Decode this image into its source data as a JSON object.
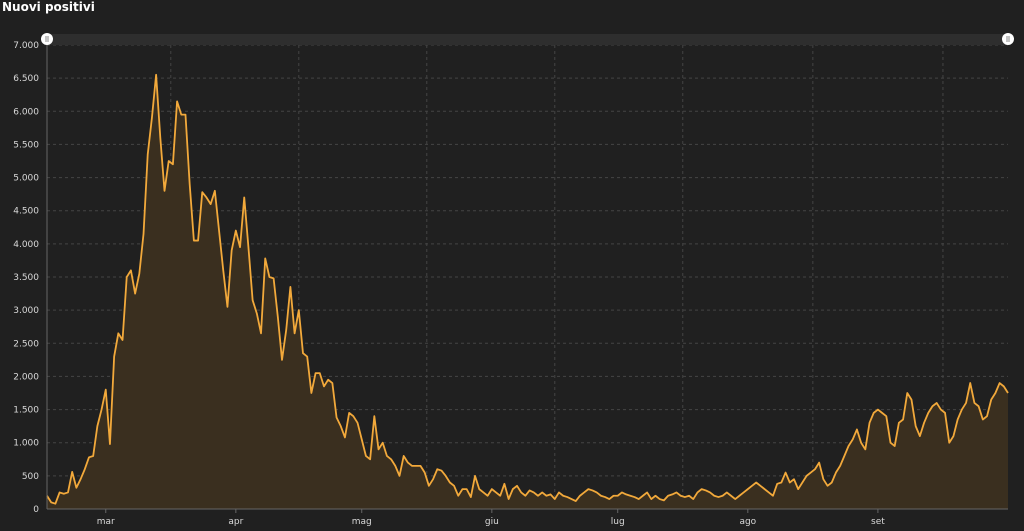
{
  "title": "Nuovi positivi",
  "colors": {
    "background": "#202020",
    "line": "#f2a93b",
    "area": "#3a2f1f",
    "grid": "#444444",
    "text": "#d8d8d8"
  },
  "chart_data": {
    "type": "area",
    "title": "Nuovi positivi",
    "ylim": [
      0,
      7000
    ],
    "grid": true,
    "y_ticks": [
      {
        "value": 0,
        "label": "0"
      },
      {
        "value": 500,
        "label": "500"
      },
      {
        "value": 1000,
        "label": "1.000"
      },
      {
        "value": 1500,
        "label": "1.500"
      },
      {
        "value": 2000,
        "label": "2.000"
      },
      {
        "value": 2500,
        "label": "2.500"
      },
      {
        "value": 3000,
        "label": "3.000"
      },
      {
        "value": 3500,
        "label": "3.500"
      },
      {
        "value": 4000,
        "label": "4.000"
      },
      {
        "value": 4500,
        "label": "4.500"
      },
      {
        "value": 5000,
        "label": "5.000"
      },
      {
        "value": 5500,
        "label": "5.500"
      },
      {
        "value": 6000,
        "label": "6.000"
      },
      {
        "value": 6500,
        "label": "6.500"
      },
      {
        "value": 7000,
        "label": "7.000"
      }
    ],
    "x_ticks": [
      {
        "index": 14,
        "label": "mar"
      },
      {
        "index": 45,
        "label": "apr"
      },
      {
        "index": 75,
        "label": "mag"
      },
      {
        "index": 106,
        "label": "giu"
      },
      {
        "index": 136,
        "label": "lug"
      },
      {
        "index": 167,
        "label": "ago"
      },
      {
        "index": 198,
        "label": "set"
      }
    ],
    "series": [
      {
        "values": [
          200,
          100,
          80,
          250,
          230,
          250,
          560,
          320,
          450,
          600,
          780,
          800,
          1250,
          1500,
          1800,
          980,
          2300,
          2650,
          2550,
          3500,
          3600,
          3250,
          3550,
          4150,
          5350,
          5900,
          6550,
          5600,
          4800,
          5250,
          5200,
          6150,
          5950,
          5950,
          4900,
          4050,
          4050,
          4780,
          4700,
          4600,
          4800,
          4200,
          3600,
          3050,
          3900,
          4200,
          3950,
          4700,
          3950,
          3150,
          2950,
          2650,
          3780,
          3500,
          3480,
          2900,
          2250,
          2700,
          3350,
          2650,
          3000,
          2350,
          2300,
          1750,
          2050,
          2050,
          1850,
          1950,
          1900,
          1380,
          1250,
          1080,
          1450,
          1400,
          1300,
          1050,
          800,
          750,
          1400,
          900,
          1000,
          800,
          750,
          650,
          500,
          800,
          700,
          650,
          650,
          650,
          550,
          350,
          450,
          600,
          580,
          500,
          400,
          350,
          200,
          300,
          300,
          180,
          500,
          300,
          250,
          200,
          300,
          250,
          200,
          380,
          150,
          300,
          350,
          250,
          200,
          280,
          250,
          200,
          250,
          200,
          220,
          150,
          250,
          200,
          180,
          150,
          120,
          200,
          250,
          300,
          280,
          250,
          200,
          180,
          150,
          200,
          200,
          250,
          220,
          200,
          180,
          150,
          200,
          250,
          150,
          200,
          150,
          130,
          200,
          220,
          250,
          200,
          180,
          200,
          150,
          250,
          300,
          280,
          250,
          200,
          180,
          200,
          250,
          200,
          150,
          200,
          250,
          300,
          350,
          400,
          350,
          300,
          250,
          200,
          380,
          400,
          550,
          400,
          450,
          300,
          400,
          500,
          550,
          600,
          700,
          450,
          350,
          400,
          550,
          650,
          800,
          950,
          1050,
          1200,
          1000,
          900,
          1300,
          1450,
          1500,
          1450,
          1400,
          1000,
          950,
          1300,
          1350,
          1750,
          1650,
          1250,
          1100,
          1300,
          1450,
          1550,
          1600,
          1500,
          1450,
          1000,
          1100,
          1350,
          1500,
          1600,
          1900,
          1600,
          1550,
          1350,
          1400,
          1650,
          1750,
          1900,
          1850,
          1750
        ]
      }
    ]
  }
}
